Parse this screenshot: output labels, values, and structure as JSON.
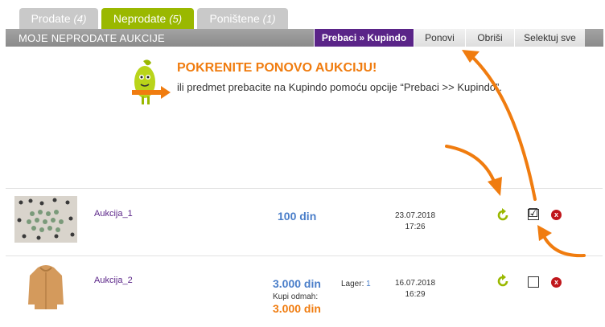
{
  "tabs": [
    {
      "label": "Prodate",
      "count": "(4)"
    },
    {
      "label": "Neprodate",
      "count": "(5)"
    },
    {
      "label": "Poništene",
      "count": "(1)"
    }
  ],
  "toolbar": {
    "title": "MOJE NEPRODATE AUKCIJE",
    "move_label": "Prebaci » Kupindo",
    "renew_label": "Ponovi",
    "delete_label": "Obriši",
    "select_all_label": "Selektuj sve"
  },
  "promo": {
    "title": "POKRENITE PONOVO AUKCIJU!",
    "text": "ili predmet prebacite na Kupindo pomoću opcije “Prebaci >> Kupindo”."
  },
  "rows": [
    {
      "name": "Aukcija_1",
      "price": "100 din",
      "date": "23.07.2018",
      "time": "17:26",
      "checked": "☑"
    },
    {
      "name": "Aukcija_2",
      "price": "3.000 din",
      "buy_now_label": "Kupi odmah:",
      "buy_now_price": "3.000 din",
      "stock_label": "Lager:",
      "stock_value": "1",
      "date": "16.07.2018",
      "time": "16:29"
    }
  ],
  "colors": {
    "accent_purple": "#5a2488",
    "accent_green": "#9ab800",
    "accent_orange": "#f07c0f",
    "price_blue": "#4a7ec9"
  },
  "icons": [
    "mascot-icon",
    "renew-icon",
    "delete-icon",
    "arrow-annotation"
  ]
}
